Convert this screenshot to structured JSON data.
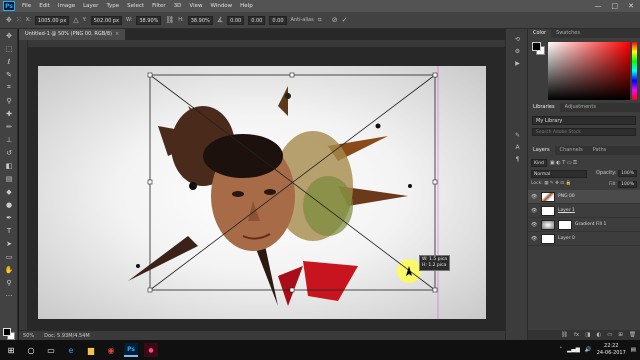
{
  "app": {
    "logo": "Ps",
    "menu": [
      "File",
      "Edit",
      "Image",
      "Layer",
      "Type",
      "Select",
      "Filter",
      "3D",
      "View",
      "Window",
      "Help"
    ],
    "window_controls": [
      "—",
      "□",
      "✕"
    ]
  },
  "options_bar": {
    "x_label": "X:",
    "x_value": "1005.00 px",
    "y_label": "Y:",
    "y_value": "502.00 px",
    "w_label": "W:",
    "w_value": "38.90%",
    "h_label": "H:",
    "h_value": "38.90%",
    "angle_value": "0.00",
    "h_skew_value": "0.00",
    "v_skew_value": "0.00",
    "interpolation": "Anti-alias",
    "icons": [
      "move-icon",
      "reference-point-icon",
      "warp-icon",
      "cancel-icon",
      "commit-icon"
    ]
  },
  "document": {
    "tab_title": "Untitled-1 @ 50% (PNG 00, RGB/8)",
    "tab_close": "×",
    "transform_tooltip": [
      "W: 1.5 pica",
      "H: 1.2 pica"
    ],
    "status_zoom": "50%",
    "status_doc": "Doc: 5.93M/4.54M"
  },
  "tools": [
    "move-icon",
    "marquee-icon",
    "lasso-icon",
    "quick-select-icon",
    "crop-icon",
    "eyedropper-icon",
    "healing-icon",
    "brush-icon",
    "stamp-icon",
    "history-brush-icon",
    "eraser-icon",
    "gradient-icon",
    "blur-icon",
    "dodge-icon",
    "pen-icon",
    "type-icon",
    "path-select-icon",
    "shape-icon",
    "hand-icon",
    "zoom-icon",
    "more-icon"
  ],
  "panels": {
    "color_tabs": [
      "Color",
      "Swatches"
    ],
    "libraries_tabs": [
      "Libraries",
      "Adjustments"
    ],
    "library_name": "My Library",
    "library_search": "Search Adobe Stock",
    "layers_tabs": [
      "Layers",
      "Channels",
      "Paths"
    ],
    "kind_label": "Kind",
    "blend_mode": "Normal",
    "opacity_label": "Opacity:",
    "opacity_value": "100%",
    "lock_label": "Lock:",
    "fill_label": "Fill:",
    "fill_value": "100%",
    "layers": [
      {
        "name": "PNG 00",
        "selected": true
      },
      {
        "name": "Layer 1",
        "selected": false
      },
      {
        "name": "Gradient Fill 1",
        "selected": false
      },
      {
        "name": "Layer 0",
        "selected": false
      }
    ]
  },
  "taskbar": {
    "start": "⊞",
    "clock_time": "22:22",
    "clock_date": "24-06-2017"
  },
  "colors": {
    "app_bg": "#535353",
    "canvas_bg": "#282828",
    "photoshop_blue": "#31a8ff"
  }
}
